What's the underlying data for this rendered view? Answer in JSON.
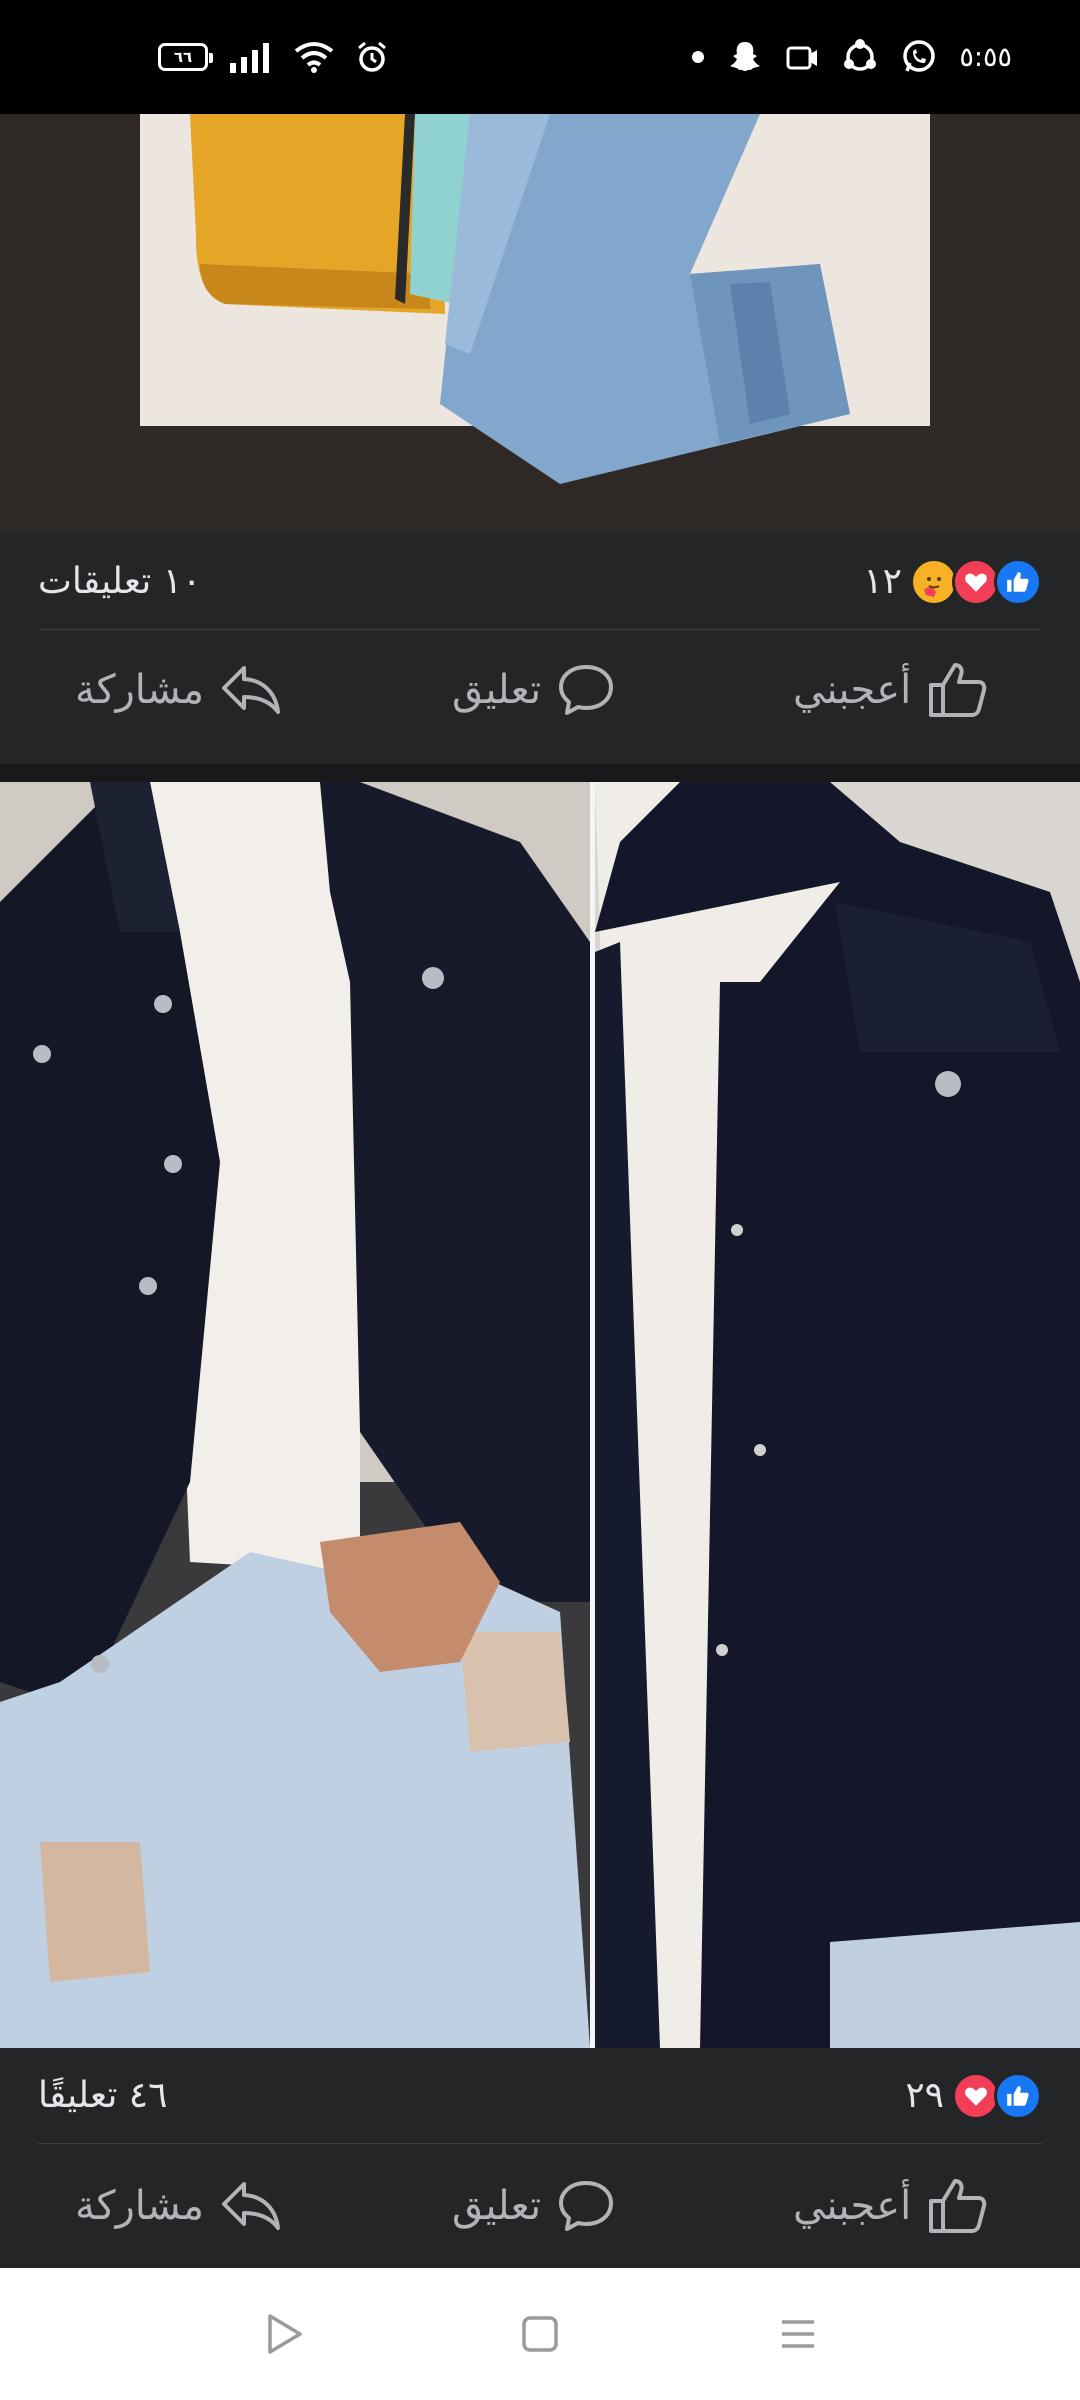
{
  "status_bar": {
    "battery": "٦٦",
    "time": "٥:٥٥",
    "left_icons": [
      "battery-icon",
      "signal-icon",
      "wifi-icon",
      "alarm-icon"
    ],
    "right_icons": [
      "dot-icon",
      "snapchat-icon",
      "app-icon",
      "sync-icon",
      "whatsapp-icon"
    ]
  },
  "posts": [
    {
      "image_alt": "jacket-and-jeans-photo",
      "reaction_count": "١٢",
      "reactions": [
        "like",
        "love",
        "care"
      ],
      "comments": "١٠ تعليقات",
      "actions": {
        "like": "أعجبني",
        "comment": "تعليق",
        "share": "مشاركة"
      }
    },
    {
      "image_alt": "denim-jacket-photo",
      "reaction_count": "٢٩",
      "reactions": [
        "like",
        "love"
      ],
      "comments": "٤٦ تعليقًا",
      "actions": {
        "like": "أعجبني",
        "comment": "تعليق",
        "share": "مشاركة"
      }
    }
  ],
  "nav_bar": {
    "icons": [
      "back-icon",
      "home-icon",
      "recents-icon"
    ]
  },
  "colors": {
    "like_blue": "#1877f2",
    "love_red": "#f33e58",
    "care_yellow": "#f7b125",
    "card_bg": "#242526",
    "page_bg": "#18191a"
  }
}
